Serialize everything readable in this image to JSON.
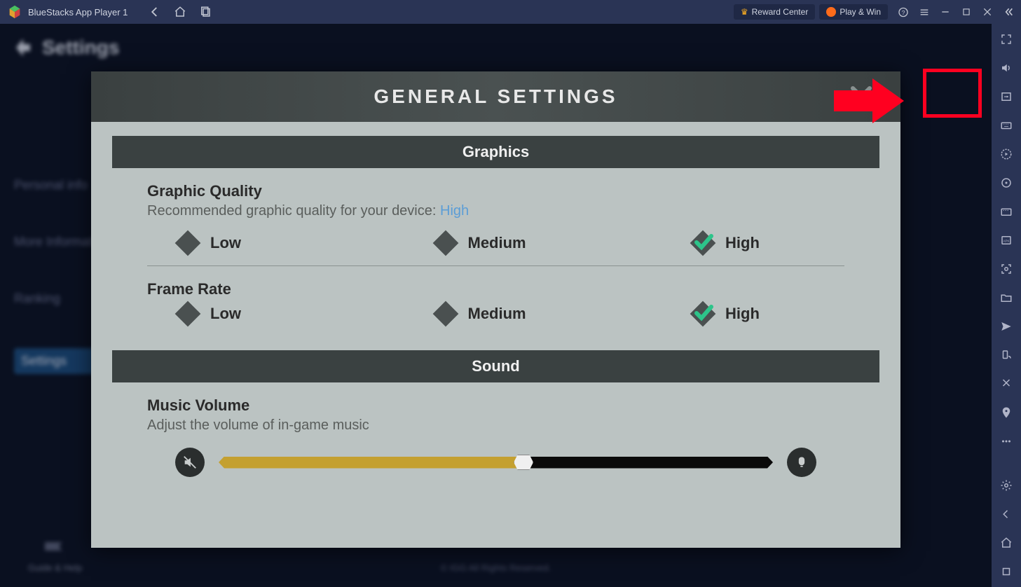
{
  "titlebar": {
    "title": "BlueStacks App Player 1",
    "reward_label": "Reward Center",
    "playwin_label": "Play & Win"
  },
  "background": {
    "settings_title": "Settings",
    "sidebar_items": [
      {
        "label": "Personal info"
      },
      {
        "label": "More Information"
      },
      {
        "label": "Ranking"
      },
      {
        "label": "Settings"
      }
    ],
    "guide_label": "Guide & Help",
    "copyright": "© IGG All Rights Reserved."
  },
  "modal": {
    "title": "GENERAL SETTINGS",
    "sections": {
      "graphics": {
        "header": "Graphics",
        "quality": {
          "title": "Graphic Quality",
          "desc_prefix": "Recommended graphic quality for your device: ",
          "desc_value": "High",
          "options": {
            "low": "Low",
            "medium": "Medium",
            "high": "High"
          },
          "selected": "high"
        },
        "framerate": {
          "title": "Frame Rate",
          "options": {
            "low": "Low",
            "medium": "Medium",
            "high": "High"
          },
          "selected": "high"
        }
      },
      "sound": {
        "header": "Sound",
        "music": {
          "title": "Music Volume",
          "desc": "Adjust the volume of in-game music",
          "value": 55
        }
      }
    }
  }
}
